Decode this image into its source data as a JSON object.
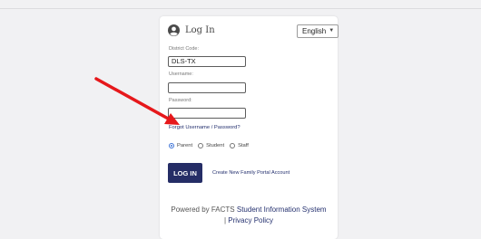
{
  "header": {
    "title": "Log In",
    "icon": "user-circle-icon"
  },
  "language": {
    "selected": "English"
  },
  "district": {
    "label": "District Code:",
    "value": "DLS-TX"
  },
  "username": {
    "label": "Username:",
    "value": ""
  },
  "password": {
    "label": "Password:",
    "value": ""
  },
  "forgot_link": "Forgot Username / Password?",
  "roles": {
    "options": [
      "Parent",
      "Student",
      "Staff"
    ],
    "selected": "Parent"
  },
  "login_button": "LOG IN",
  "create_account_link": "Create New Family Portal Account",
  "footer": {
    "prefix": "Powered by FACTS ",
    "link1": "Student Information System",
    "separator": " | ",
    "link2": "Privacy Policy"
  },
  "colors": {
    "accent": "#252d66",
    "annotation_arrow": "#e6181b",
    "radio_selected": "#3e73d6",
    "background": "#f1f1f3"
  }
}
